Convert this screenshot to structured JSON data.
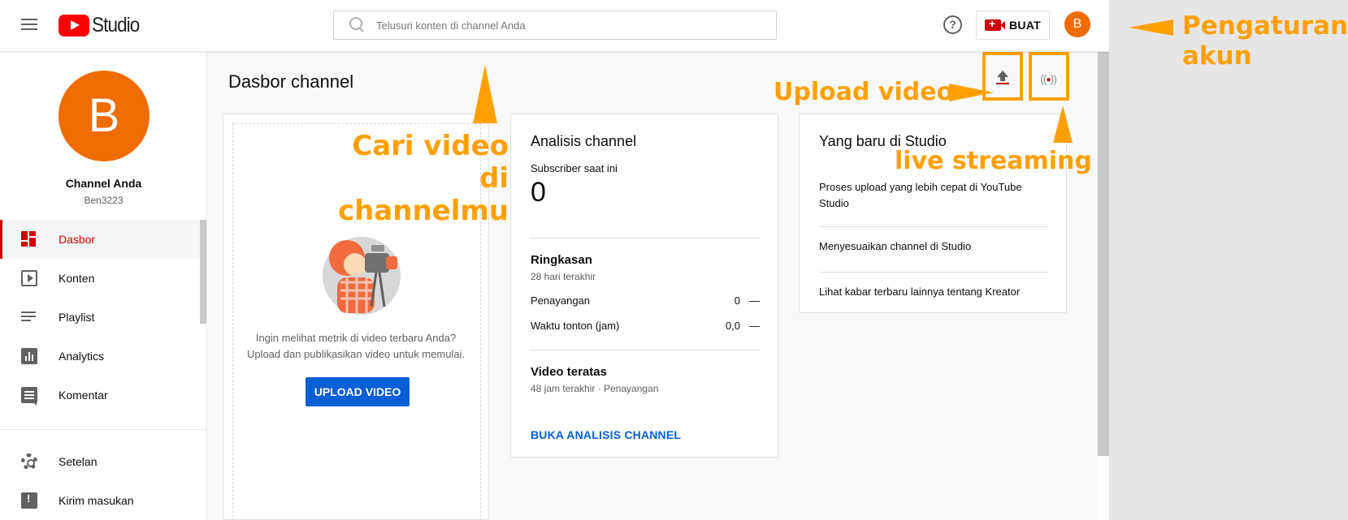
{
  "header": {
    "logo_text": "Studio",
    "search_placeholder": "Telusuri konten di channel Anda",
    "help_label": "?",
    "create_label": "BUAT",
    "avatar_initial": "B"
  },
  "sidebar": {
    "avatar_initial": "B",
    "channel_name": "Channel Anda",
    "channel_handle": "Ben3223",
    "items": [
      {
        "label": "Dasbor",
        "icon": "dashboard-icon",
        "active": true
      },
      {
        "label": "Konten",
        "icon": "content-icon",
        "active": false
      },
      {
        "label": "Playlist",
        "icon": "playlist-icon",
        "active": false
      },
      {
        "label": "Analytics",
        "icon": "analytics-icon",
        "active": false
      },
      {
        "label": "Komentar",
        "icon": "comment-icon",
        "active": false
      }
    ],
    "bottom_items": [
      {
        "label": "Setelan",
        "icon": "gear-icon"
      },
      {
        "label": "Kirim masukan",
        "icon": "feedback-icon"
      }
    ]
  },
  "main": {
    "title": "Dasbor channel",
    "upload_card": {
      "message_line1": "Ingin melihat metrik di video terbaru Anda?",
      "message_line2": "Upload dan publikasikan video untuk memulai.",
      "button_label": "UPLOAD VIDEO"
    },
    "analytics_card": {
      "title": "Analisis channel",
      "subscriber_label": "Subscriber saat ini",
      "subscriber_count": "0",
      "summary_title": "Ringkasan",
      "summary_period": "28 hari terakhir",
      "rows": [
        {
          "label": "Penayangan",
          "value": "0",
          "delta": "—"
        },
        {
          "label": "Waktu tonton (jam)",
          "value": "0,0",
          "delta": "—"
        }
      ],
      "top_videos_title": "Video teratas",
      "top_videos_period": "48 jam terakhir · Penayangan",
      "link_label": "BUKA ANALISIS CHANNEL"
    },
    "news_card": {
      "title": "Yang baru di Studio",
      "items": [
        "Proses upload yang lebih cepat di YouTube Studio",
        "Menyesuaikan channel di Studio",
        "Lihat kabar terbaru lainnya tentang Kreator"
      ]
    }
  },
  "annotations": {
    "search": "Cari video\ndi channelmu",
    "upload": "Upload video",
    "live": "live streaming",
    "account": "Pengaturan\nakun",
    "color": "#ffa000"
  },
  "colors": {
    "accent": "#cc0000",
    "avatar": "#ef6c00",
    "link": "#065fd4"
  }
}
